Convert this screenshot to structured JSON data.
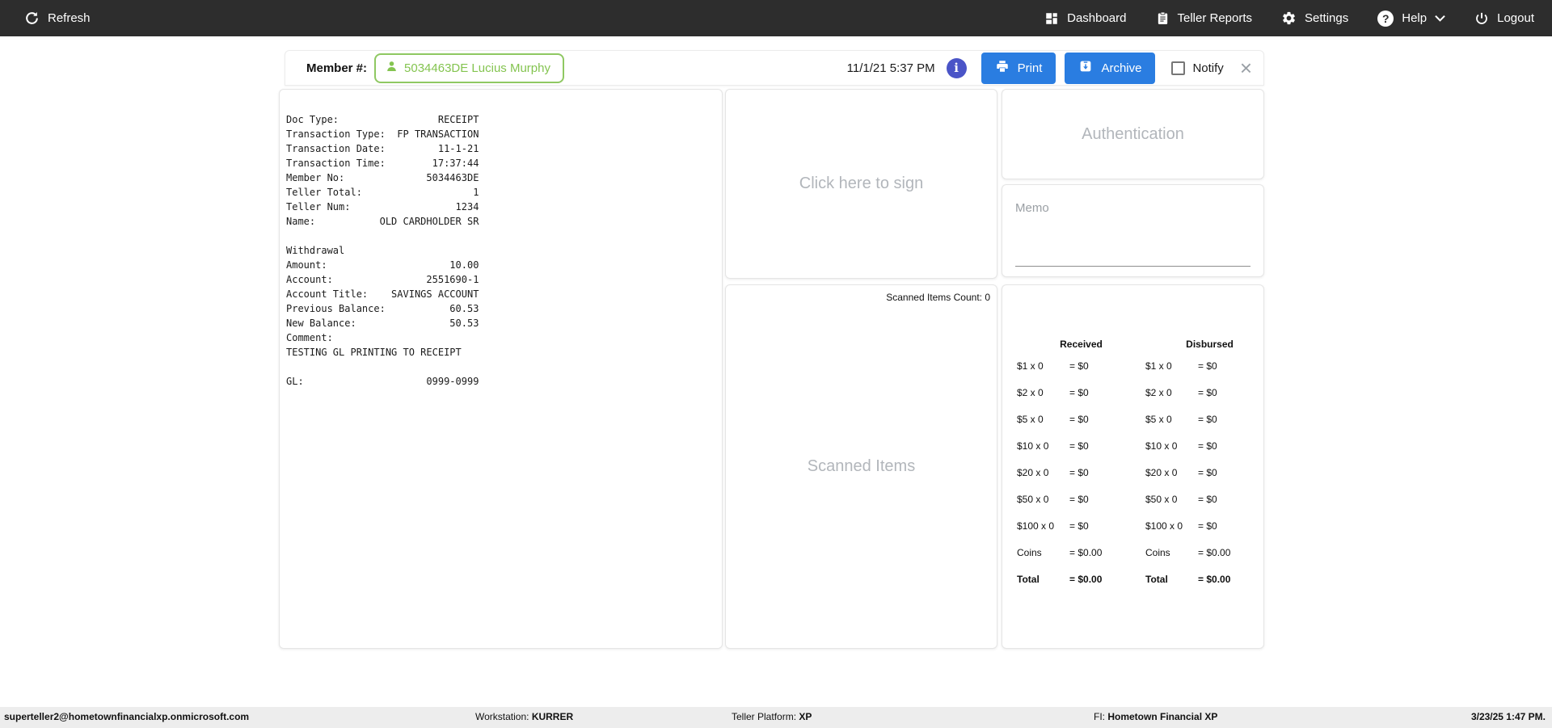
{
  "navbar": {
    "refresh_label": "Refresh",
    "items": [
      {
        "label": "Dashboard"
      },
      {
        "label": "Teller Reports"
      },
      {
        "label": "Settings"
      },
      {
        "label": "Help"
      },
      {
        "label": "Logout"
      }
    ],
    "help_glyph": "?"
  },
  "member_bar": {
    "label": "Member #:",
    "member_value": "5034463DE Lucius Murphy",
    "datetime": "11/1/21 5:37 PM",
    "info_glyph": "i",
    "print_label": "Print",
    "archive_label": "Archive",
    "notify_label": "Notify",
    "close_glyph": "×"
  },
  "receipt": {
    "text": "Doc Type:                 RECEIPT\nTransaction Type:  FP TRANSACTION\nTransaction Date:         11-1-21\nTransaction Time:        17:37:44\nMember No:              5034463DE\nTeller Total:                   1\nTeller Num:                  1234\nName:           OLD CARDHOLDER SR\n\nWithdrawal\nAmount:                     10.00\nAccount:                2551690-1\nAccount Title:    SAVINGS ACCOUNT\nPrevious Balance:           60.53\nNew Balance:                50.53\nComment:\nTESTING GL PRINTING TO RECEIPT\n\nGL:                     0999-0999"
  },
  "sign_panel": {
    "placeholder": "Click here to sign"
  },
  "scanned_panel": {
    "count_label": "Scanned Items Count: 0",
    "placeholder": "Scanned Items"
  },
  "auth_panel": {
    "placeholder": "Authentication"
  },
  "memo_panel": {
    "label": "Memo"
  },
  "cash": {
    "received_header": "Received",
    "disbursed_header": "Disbursed",
    "rows": [
      {
        "rl": "$1 x 0",
        "rv": "= $0",
        "dl": "$1 x 0",
        "dv": "= $0"
      },
      {
        "rl": "$2 x 0",
        "rv": "= $0",
        "dl": "$2 x 0",
        "dv": "= $0"
      },
      {
        "rl": "$5 x 0",
        "rv": "= $0",
        "dl": "$5 x 0",
        "dv": "= $0"
      },
      {
        "rl": "$10 x 0",
        "rv": "= $0",
        "dl": "$10 x 0",
        "dv": "= $0"
      },
      {
        "rl": "$20 x 0",
        "rv": "= $0",
        "dl": "$20 x 0",
        "dv": "= $0"
      },
      {
        "rl": "$50 x 0",
        "rv": "= $0",
        "dl": "$50 x 0",
        "dv": "= $0"
      },
      {
        "rl": "$100 x 0",
        "rv": "= $0",
        "dl": "$100 x 0",
        "dv": "= $0"
      },
      {
        "rl": "Coins",
        "rv": "= $0.00",
        "dl": "Coins",
        "dv": "= $0.00"
      },
      {
        "rl": "Total",
        "rv": "= $0.00",
        "dl": "Total",
        "dv": "= $0.00"
      }
    ]
  },
  "footer": {
    "user": "superteller2@hometownfinancialxp.onmicrosoft.com",
    "workstation_label": "Workstation:",
    "workstation_value": "KURRER",
    "platform_label": "Teller Platform:",
    "platform_value": "XP",
    "fi_label": "FI:",
    "fi_value": "Hometown Financial XP",
    "datetime": "3/23/25 1:47 PM."
  },
  "colors": {
    "navbar_bg": "#2d2d2d",
    "accent_blue": "#2a7de1",
    "accent_green": "#84c450",
    "info_indigo": "#4a54c7"
  }
}
